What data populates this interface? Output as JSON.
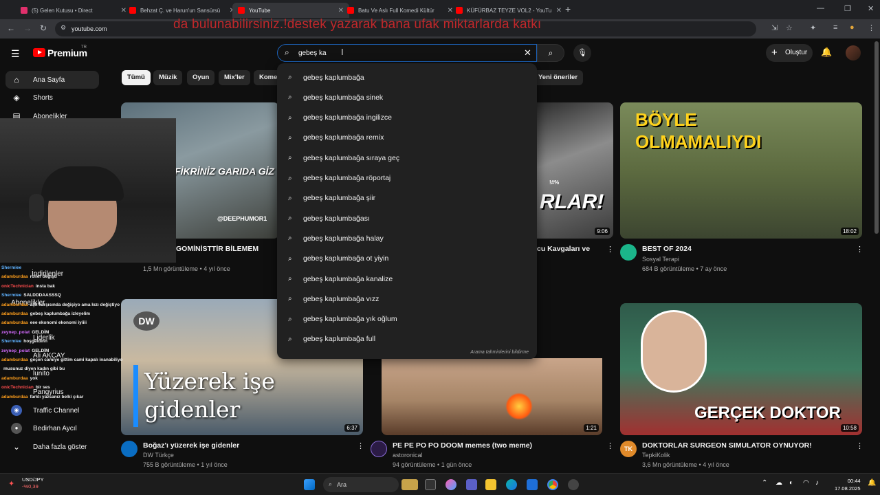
{
  "browser": {
    "tabs": [
      {
        "title": "(5) Gelen Kutusu • Direct",
        "active": false,
        "color": "#e1306c"
      },
      {
        "title": "Behzat Ç. ve Harun'un Sansürsü",
        "active": false,
        "color": "#ff0000"
      },
      {
        "title": "YouTube",
        "active": true,
        "color": "#ff0000"
      },
      {
        "title": "Batu Ve Aslı Full Komedi Kültür",
        "active": false,
        "color": "#ff0000"
      },
      {
        "title": "KÜFÜRBAZ TEYZE VOL2 - YouTu",
        "active": false,
        "color": "#ff0000"
      }
    ],
    "new_tab": "+",
    "url": "youtube.com"
  },
  "stream_overlay": {
    "banner": "da bulunabilirsiniz.!destek yazarak bana ufak miktarlarda katkı"
  },
  "header": {
    "logo": "Premium",
    "logo_region": "TR",
    "search_value": "gebeş ka",
    "create_label": "Oluştur"
  },
  "sidebar": {
    "items": [
      {
        "label": "Ana Sayfa",
        "icon": "home-icon",
        "active": true
      },
      {
        "label": "Shorts",
        "icon": "shorts-icon"
      },
      {
        "label": "Abonelikler",
        "icon": "subscriptions-icon"
      },
      {
        "label": "İndirilenler"
      },
      {
        "label": "Abonelikler"
      },
      {
        "label": "Liderlik"
      },
      {
        "label": "Ali AKCAY"
      },
      {
        "label": "lunito"
      },
      {
        "label": "Pangyrius"
      },
      {
        "label": "Traffic Channel"
      },
      {
        "label": "Bedirhan Aycıl"
      },
      {
        "label": "Daha fazla göster"
      }
    ]
  },
  "chips": [
    "Tümü",
    "Müzik",
    "Oyun",
    "Mix'ler",
    "Kome",
    "Yeni öneriler"
  ],
  "suggestions": {
    "prefix": "gebeş ka",
    "items": [
      "gebeş kaplumbağa",
      "gebeş kaplumbağa sinek",
      "gebeş kaplumbağa ingilizce",
      "gebeş kaplumbağa remix",
      "gebeş kaplumbağa sıraya geç",
      "gebeş kaplumbağa röportaj",
      "gebeş kaplumbağa şiir",
      "gebeş kaplumbağası",
      "gebeş kaplumbağa halay",
      "gebeş kaplumbağa ot yiyin",
      "gebeş kaplumbağa kanalize",
      "gebeş kaplumbağa vızz",
      "gebeş kaplumbağa yık oğlum",
      "gebeş kaplumbağa full"
    ],
    "report_label": "Arama tahminlerini bildirme"
  },
  "videos": {
    "row1": [
      {
        "thumb_text": "FİKRİNİZ GARIDA GİZ",
        "watermark": "@DEEPHUMOR1",
        "title": "GOMİNİSTTİR BİLEMEM",
        "meta": "1,5 Mn görüntüleme • 4 yıl önce"
      },
      {
        "thumb_text": "RLAR!",
        "thumb_sub": "!#%",
        "duration": "9:06",
        "title": "cu Kavgaları ve"
      },
      {
        "thumb_text_1": "BÖYLE",
        "thumb_text_2": "OLMAMALIYDI",
        "duration": "18:02",
        "title": "BEST OF 2024",
        "channel": "Sosyal Terapi",
        "meta": "684 B görüntüleme • 7 ay önce"
      }
    ],
    "row2": [
      {
        "thumb_text_1": "Yüzerek işe",
        "thumb_text_2": "gidenler",
        "logo": "DW",
        "duration": "6:37",
        "title": "Boğaz'ı yüzerek işe gidenler",
        "channel": "DW Türkçe",
        "meta": "755 B görüntüleme • 1 yıl önce"
      },
      {
        "duration": "1:21",
        "title": "PE PE PO PO DOOM memes (two meme)",
        "channel": "astoronical",
        "meta": "94 görüntüleme • 1 gün önce"
      },
      {
        "thumb_text": "GERÇEK DOKTOR",
        "duration": "10:58",
        "title": "DOKTORLAR SURGEON SIMULATOR OYNUYOR!",
        "channel": "TepkiKolik",
        "channel_badge": "TK",
        "meta": "3,6 Mn görüntüleme • 4 yıl önce"
      }
    ]
  },
  "chat": [
    {
      "user": "Shermiee",
      "msg": "",
      "color": "#5fb2ff"
    },
    {
      "user": "adamburdaa",
      "msg": "roller değiştİ",
      "color": "#ff9f1c"
    },
    {
      "user": "onicTechnician",
      "msg": "insta bak",
      "color": "#ff4d4d"
    },
    {
      "user": "Shermiee",
      "msg": "SALDDDAASSSQ",
      "color": "#5fb2ff"
    },
    {
      "user": "adamburdaa",
      "msg": "aşk karşısında değişiyo ama kızı değiştiyo",
      "color": "#ff9f1c"
    },
    {
      "user": "adamburdaa",
      "msg": "gebeş kaplumbağa izleyelim",
      "color": "#ff9f1c"
    },
    {
      "user": "adamburdaa",
      "msg": "eee ekonomi ekonomi iyiiii",
      "color": "#ff9f1c"
    },
    {
      "user": "zeynep_polat",
      "msg": "GELDİM",
      "color": "#d46bff"
    },
    {
      "user": "Shermiee",
      "msg": "hoşgeldinn",
      "color": "#5fb2ff"
    },
    {
      "user": "zeynep_polat",
      "msg": "GELDİM",
      "color": "#d46bff"
    },
    {
      "user": "adamburdaa",
      "msg": "geçen camiye gittim cami kapalı inanabiliyo",
      "color": "#ff9f1c"
    },
    {
      "user": "",
      "msg": "musunuz diyen kadın gibi bu",
      "color": "#ff9f1c"
    },
    {
      "user": "adamburdaa",
      "msg": "yok",
      "color": "#ff9f1c"
    },
    {
      "user": "onicTechnician",
      "msg": "bir ses",
      "color": "#ff4d4d"
    },
    {
      "user": "adamburdaa",
      "msg": "farklı yazsanız belki çıkar",
      "color": "#ff9f1c"
    }
  ],
  "taskbar": {
    "stock_name": "USD/JPY",
    "stock_change": "-%0,39",
    "search_label": "Ara",
    "time": "00:44",
    "date": "17.08.2025"
  }
}
